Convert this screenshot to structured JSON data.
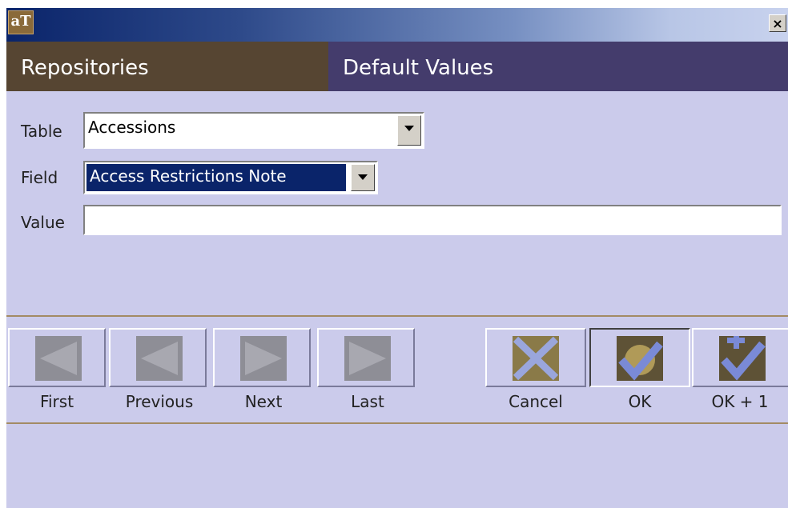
{
  "window": {
    "app_icon_text": "aT",
    "close_label": "×"
  },
  "header": {
    "left_title": "Repositories",
    "right_title": "Default Values"
  },
  "form": {
    "table_label": "Table",
    "table_value": "Accessions",
    "field_label": "Field",
    "field_value": "Access Restrictions Note",
    "value_label": "Value",
    "value_value": ""
  },
  "nav_buttons": {
    "first": "First",
    "previous": "Previous",
    "next": "Next",
    "last": "Last"
  },
  "action_buttons": {
    "cancel": "Cancel",
    "ok": "OK",
    "ok_plus_one": "OK + 1"
  },
  "colors": {
    "accent_left": "#564532",
    "accent_right": "#443c6c",
    "panel": "#cbcbeb",
    "icon_olive": "#8a7a48",
    "icon_check": "#7a8ad6"
  }
}
